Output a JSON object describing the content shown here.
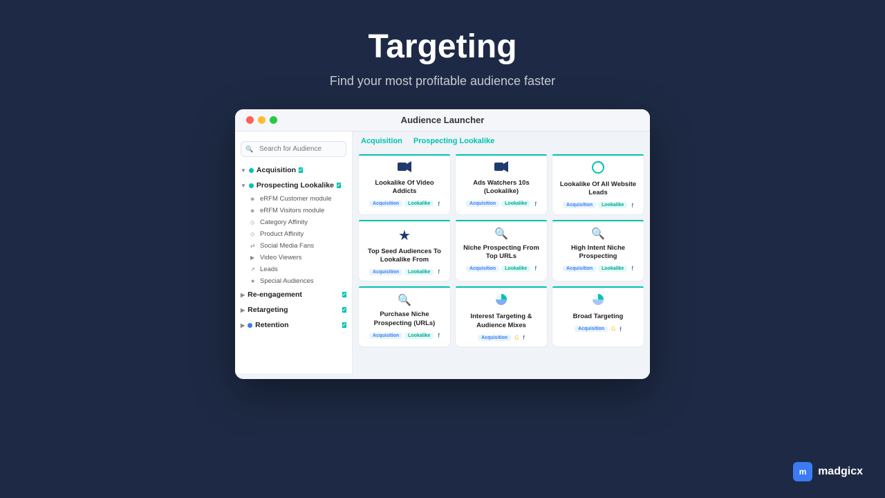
{
  "page": {
    "title": "Targeting",
    "subtitle": "Find your most profitable audience faster"
  },
  "window": {
    "title": "Audience Launcher"
  },
  "tabs": [
    {
      "label": "Acquisition",
      "active": true
    },
    {
      "label": "Prospecting Lookalike",
      "active": true
    }
  ],
  "search": {
    "placeholder": "Search for Audience"
  },
  "sidebar": {
    "categories": [
      {
        "label": "Acquisition",
        "checked": true
      },
      {
        "label": "Prospecting Lookalike",
        "checked": true
      },
      {
        "label": "eRFM Customer module",
        "checked": false
      },
      {
        "label": "eRFM Visitors module",
        "checked": false
      },
      {
        "label": "Category Affinity",
        "checked": false
      },
      {
        "label": "Product Affinity",
        "checked": false
      },
      {
        "label": "Social Media Fans",
        "checked": false
      },
      {
        "label": "Video Viewers",
        "checked": false
      },
      {
        "label": "Leads",
        "checked": false
      },
      {
        "label": "Special Audiences",
        "checked": false
      },
      {
        "label": "Re-engagement",
        "checked": true
      },
      {
        "label": "Retargeting",
        "checked": true
      },
      {
        "label": "Retention",
        "checked": true
      }
    ]
  },
  "cards": [
    {
      "title": "Lookalike Of Video Addicts",
      "icon": "🎬",
      "tags": [
        "Acquisition",
        "Lookalike"
      ],
      "platform": "fb"
    },
    {
      "title": "Ads Watchers 10s (Lookalike)",
      "icon": "🎬",
      "tags": [
        "Acquisition",
        "Lookalike"
      ],
      "platform": "fb"
    },
    {
      "title": "Lookalike Of All Website Leads",
      "icon": "◑",
      "tags": [
        "Acquisition",
        "Lookalike"
      ],
      "platform": "fb"
    },
    {
      "title": "Top Seed Audiences To Lookalike From",
      "icon": "★",
      "tags": [
        "Acquisition",
        "Lookalike"
      ],
      "platform": "fb"
    },
    {
      "title": "Niche Prospecting From Top URLs",
      "icon": "🔍",
      "tags": [
        "Acquisition",
        "Lookalike"
      ],
      "platform": "fb"
    },
    {
      "title": "High Intent Niche Prospecting",
      "icon": "🔍",
      "tags": [
        "Acquisition",
        "Lookalike"
      ],
      "platform": "fb"
    },
    {
      "title": "Purchase Niche Prospecting (URLs)",
      "icon": "🔍",
      "tags": [
        "Acquisition",
        "Lookalike"
      ],
      "platform": "fb"
    },
    {
      "title": "Interest Targeting & Audience Mixes",
      "icon": "◑",
      "tags": [
        "Acquisition"
      ],
      "platform": "fb-google"
    },
    {
      "title": "Broad Targeting",
      "icon": "◑",
      "tags": [
        "Acquisition"
      ],
      "platform": "fb-google"
    }
  ],
  "madgicx": {
    "label": "madgicx"
  }
}
